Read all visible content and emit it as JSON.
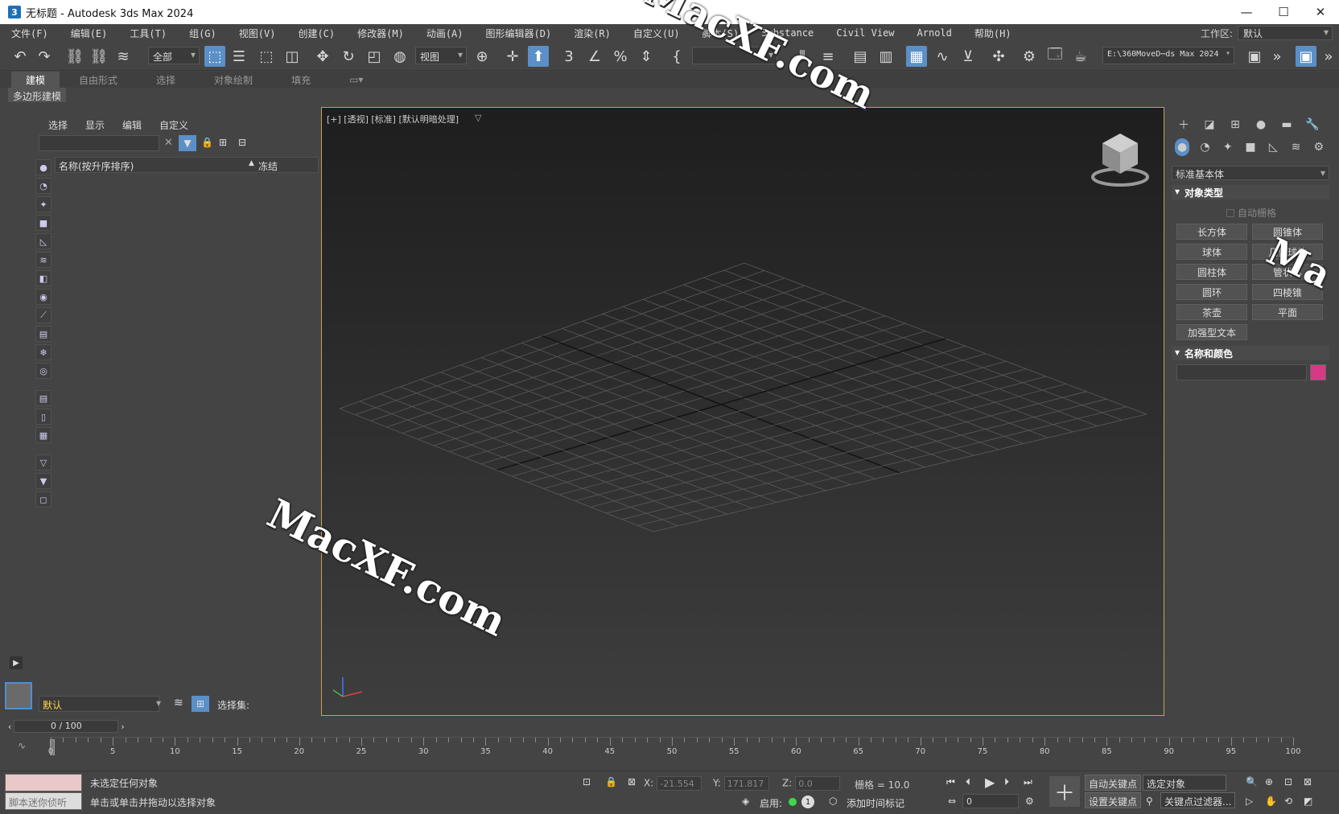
{
  "window": {
    "title": "无标题 - Autodesk 3ds Max 2024",
    "app_icon": "3"
  },
  "menu": [
    "文件(F)",
    "编辑(E)",
    "工具(T)",
    "组(G)",
    "视图(V)",
    "创建(C)",
    "修改器(M)",
    "动画(A)",
    "图形编辑器(D)",
    "渲染(R)",
    "自定义(U)",
    "脚本(S)",
    "Substance",
    "Civil View",
    "Arnold",
    "帮助(H)"
  ],
  "workspace": {
    "label": "工作区:",
    "value": "默认"
  },
  "toolbar": {
    "selection_filter": "全部",
    "ref_coord": "视图",
    "project_path": "E:\\360MoveD⋯ds Max 2024"
  },
  "ribbon": {
    "tabs": [
      "建模",
      "自由形式",
      "选择",
      "对象绘制",
      "填充"
    ],
    "sub_tab": "多边形建模"
  },
  "scene_explorer": {
    "menu": [
      "选择",
      "显示",
      "编辑",
      "自定义"
    ],
    "col_name": "名称(按升序排序)",
    "col_frozen": "冻结",
    "sort_arrow": "▲"
  },
  "viewport": {
    "label": "[+] [透视] [标准] [默认明暗处理]"
  },
  "command_panel": {
    "category": "标准基本体",
    "object_type_title": "对象类型",
    "autogrid": "自动栅格",
    "buttons": [
      "长方体",
      "圆锥体",
      "球体",
      "几何球体",
      "圆柱体",
      "管状体",
      "圆环",
      "四棱锥",
      "茶壶",
      "平面",
      "加强型文本"
    ],
    "name_color_title": "名称和颜色",
    "color": "#d63a84"
  },
  "layer": {
    "current": "默认",
    "selection_set_label": "选择集:"
  },
  "time_slider": {
    "value": "0 / 100"
  },
  "timeline": {
    "labels": [
      "0",
      "5",
      "10",
      "15",
      "20",
      "25",
      "30",
      "35",
      "40",
      "45",
      "50",
      "55",
      "60",
      "65",
      "70",
      "75",
      "80",
      "85",
      "90",
      "95",
      "100"
    ]
  },
  "status": {
    "line1": "未选定任何对象",
    "line2": "单击或单击并拖动以选择对象",
    "maxscript_hint": "脚本迷你侦听",
    "x_label": "X:",
    "x": "-21.554",
    "y_label": "Y:",
    "y": "171.817",
    "z_label": "Z:",
    "z": "0.0",
    "grid": "栅格 = 10.0",
    "enable": "启用:",
    "add_time_tag": "添加时间标记",
    "auto_key": "自动关键点",
    "set_key": "设置关键点",
    "selected": "选定对象",
    "key_filters": "关键点过滤器...",
    "frame": "0"
  },
  "watermark": {
    "text": "MacXF.com",
    "text_short": "Ma"
  }
}
